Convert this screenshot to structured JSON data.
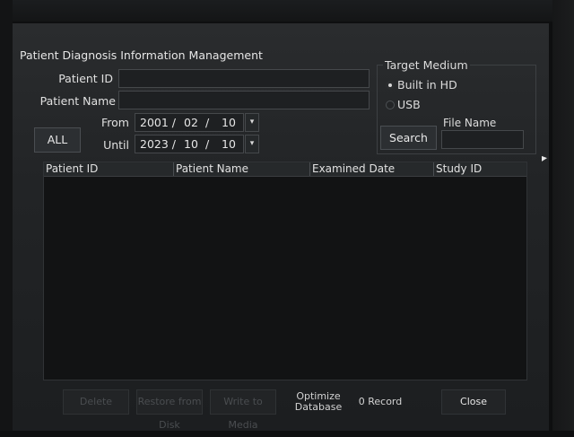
{
  "window": {
    "title": "Patient Diagnosis Information Management"
  },
  "form": {
    "patient_id_label": "Patient ID",
    "patient_id_value": "",
    "patient_name_label": "Patient Name",
    "patient_name_value": "",
    "all_button": "ALL",
    "from_label": "From",
    "from_year": "2001 /",
    "from_month": "02",
    "from_sep": "/",
    "from_day": "10",
    "until_label": "Until",
    "until_year": "2023 /",
    "until_month": "10",
    "until_sep": "/",
    "until_day": "10"
  },
  "target": {
    "title": "Target Medium",
    "options": [
      {
        "label": "Built in HD",
        "selected": true
      },
      {
        "label": "USB",
        "selected": false
      }
    ],
    "search_button": "Search",
    "file_name_label": "File Name",
    "file_name_value": ""
  },
  "table": {
    "columns": [
      "Patient ID",
      "Patient Name",
      "Examined Date",
      "Study ID"
    ],
    "rows": []
  },
  "footer": {
    "disabled_buttons": [
      "Delete",
      "Restore from Disk",
      "Write to Media"
    ],
    "optimize_line1": "Optimize",
    "optimize_line2": "Database",
    "record_count": "0 Record",
    "close_button": "Close"
  },
  "colors": {
    "background": "#222426",
    "text": "#e6e6e6",
    "table_bg": "#121314"
  }
}
